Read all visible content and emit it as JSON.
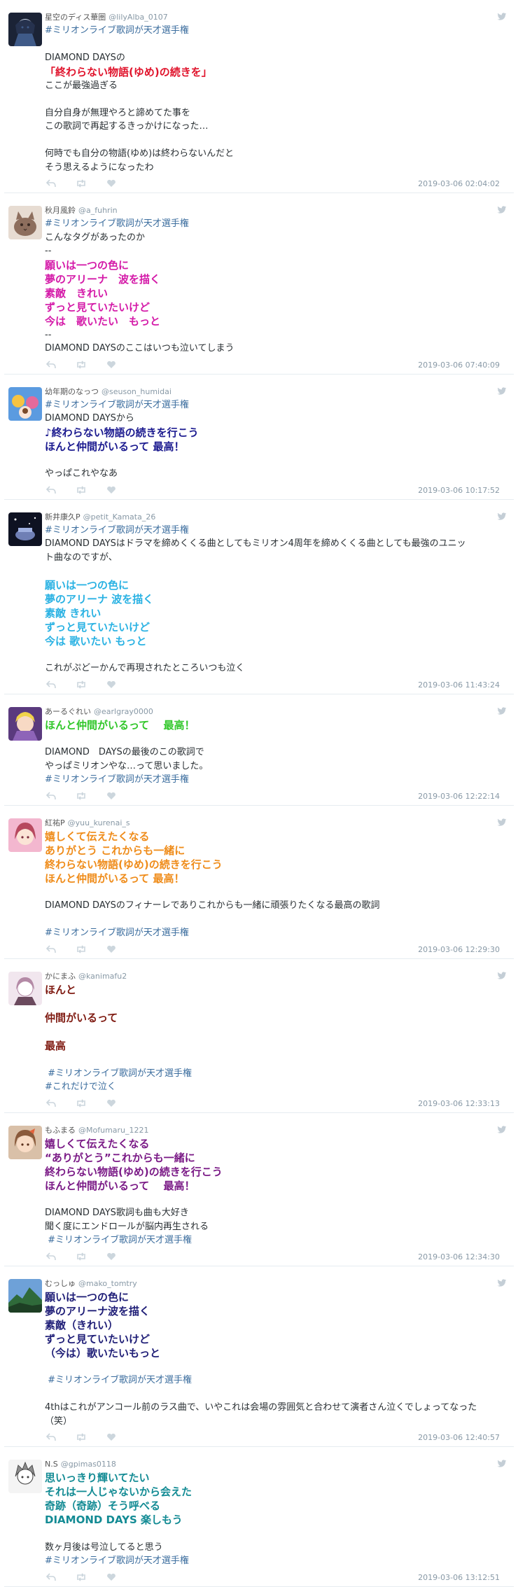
{
  "tweets": [
    {
      "name": "星空のディス華圏",
      "handle": "@lilyAlba_0107",
      "time": "2019-03-06 02:04:02",
      "avatar": {
        "kind": "dark-anime",
        "colors": [
          "#1b2336",
          "#3f5a88",
          "#dfe8f5"
        ]
      },
      "lines": [
        "#ミリオンライブ歌詞が天才選手権",
        "",
        "DIAMOND DAYSの",
        "「終わらない物語(ゆめ)の続きを」",
        "ここが最強過ぎる",
        "",
        "自分自身が無理やろと諦めてた事を",
        "この歌詞で再起するきっかけになった…",
        "",
        "何時でも自分の物語(ゆめ)は終わらないんだと",
        "そう思えるようになったわ"
      ],
      "accent_color": "#e0142c"
    },
    {
      "name": "秋月風鈴",
      "handle": "@a_fuhrin",
      "time": "2019-03-06 07:40:09",
      "avatar": {
        "kind": "cat",
        "colors": [
          "#e7dcd2",
          "#8d6e5d",
          "#3a2a22"
        ]
      },
      "lines": [
        "#ミリオンライブ歌詞が天才選手権",
        "こんなタグがあったのか",
        "--",
        "願いは一つの色に",
        "夢のアリーナ　波を描く",
        "素敵　きれい",
        "ずっと見ていたいけど",
        "今は　歌いたい　もっと",
        "--",
        "DIAMOND DAYSのここはいつも泣いてしまう"
      ],
      "accent_color": "#d41aa8"
    },
    {
      "name": "幼年期のなっつ",
      "handle": "@seuson_humidai",
      "time": "2019-03-06 10:17:52",
      "avatar": {
        "kind": "idol-group",
        "colors": [
          "#5b9be0",
          "#f6c343",
          "#e46a9b"
        ]
      },
      "lines": [
        "#ミリオンライブ歌詞が天才選手権",
        "DIAMOND DAYSから",
        "♪終わらない物語の続きを行こう",
        "ほんと仲間がいるって 最高！",
        "",
        "やっぱこれやなあ"
      ],
      "accent_color": "#1b1a8f"
    },
    {
      "name": "新井康久P",
      "handle": "@petit_Kamata_26",
      "time": "2019-03-06 11:43:24",
      "avatar": {
        "kind": "night-stage",
        "colors": [
          "#0e1222",
          "#6f7fb5",
          "#ffffff"
        ]
      },
      "lines": [
        "#ミリオンライブ歌詞が天才選手権",
        "DIAMOND DAYSはドラマを締めくくる曲としてもミリオン4周年を締めくくる曲としても最強のユニッ",
        "ト曲なのですが、",
        "",
        "願いは一つの色に",
        "夢のアリーナ 波を描く",
        "素敵 きれい",
        "ずっと見ていたいけど",
        "今は 歌いたい もっと",
        "",
        "これがぷどーかんで再現されたところいつも泣く"
      ],
      "accent_color": "#2ab2e3"
    },
    {
      "name": "あーるぐれい",
      "handle": "@earlgray0000",
      "time": "2019-03-06 12:22:14",
      "avatar": {
        "kind": "purple-idol",
        "colors": [
          "#5a3a7e",
          "#f0d24a",
          "#f7d9c4"
        ]
      },
      "lines": [
        "ほんと仲間がいるって　 最高！",
        "",
        "DIAMOND　DAYSの最後のこの歌詞で",
        "やっぱミリオンやな…って思いました。",
        "#ミリオンライブ歌詞が天才選手権"
      ],
      "accent_color": "#31c72a"
    },
    {
      "name": "紅祐P",
      "handle": "@yuu_kurenai_s",
      "time": "2019-03-06 12:29:30",
      "avatar": {
        "kind": "pink-idol",
        "colors": [
          "#f3b7cf",
          "#b7485e",
          "#fbe4d6"
        ]
      },
      "lines": [
        "嬉しくて伝えたくなる",
        "ありがとう これからも一緒に",
        "終わらない物語(ゆめ)の続きを行こう",
        "ほんと仲間がいるって 最高！",
        "",
        "DIAMOND DAYSのフィナーレでありこれからも一緒に頑張りたくなる最高の歌詞",
        "",
        "#ミリオンライブ歌詞が天才選手権"
      ],
      "accent_color": "#ef8c1a"
    },
    {
      "name": "かにまふ",
      "handle": "@kanimafu2",
      "time": "2019-03-06 12:33:13",
      "avatar": {
        "kind": "sketch-girl",
        "colors": [
          "#f1e6ee",
          "#b48aa6",
          "#6b4a5e"
        ]
      },
      "lines": [
        "ほんと",
        "",
        "仲間がいるって",
        "",
        "最高",
        "",
        " #ミリオンライブ歌詞が天才選手権",
        "#これだけで泣く"
      ],
      "accent_color": "#7f1b12"
    },
    {
      "name": "もふまる",
      "handle": "@Mofumaru_1221",
      "time": "2019-03-06 12:34:30",
      "avatar": {
        "kind": "brown-idol",
        "colors": [
          "#8a5a3b",
          "#e2633d",
          "#f9dcc6"
        ]
      },
      "lines": [
        "嬉しくて伝えたくなる",
        "“ありがとう”これからも一緒に",
        "終わらない物語(ゆめ)の続きを行こう",
        "ほんと仲間がいるって　 最高！",
        "",
        "DIAMOND DAYS歌詞も曲も大好き",
        "聞く度にエンドロールが脳内再生される",
        " #ミリオンライブ歌詞が天才選手権"
      ],
      "accent_color": "#7a1a86"
    },
    {
      "name": "むっしゅ",
      "handle": "@mako_tomtry",
      "time": "2019-03-06 12:40:57",
      "avatar": {
        "kind": "mountain",
        "colors": [
          "#6ea1d8",
          "#2f6a3a",
          "#1d3f24"
        ]
      },
      "lines": [
        "願いは一つの色に",
        "夢のアリーナ波を描く",
        "素敵（きれい）",
        "ずっと見ていたいけど",
        "（今は）歌いたいもっと",
        "",
        " #ミリオンライブ歌詞が天才選手権",
        "",
        "4thはこれがアンコール前のラス曲で、いやこれは会場の雰囲気と合わせて演者さん泣くでしょってなった",
        "（笑）"
      ],
      "accent_color": "#1f1e77"
    },
    {
      "name": "N.S",
      "handle": "@gpimas0118",
      "time": "2019-03-06 13:12:51",
      "avatar": {
        "kind": "manga-sketch",
        "colors": [
          "#f4f4f4",
          "#8b8b8b",
          "#3c3c3c"
        ]
      },
      "lines": [
        "思いっきり輝いてたい",
        "それは一人じゃないから会えた",
        "奇跡（奇跡）そう呼べる",
        "DIAMOND DAYS 楽しもう",
        "",
        "数ヶ月後は号泣してると思う",
        "#ミリオンライブ歌詞が天才選手権"
      ],
      "accent_color": "#138b94"
    }
  ]
}
